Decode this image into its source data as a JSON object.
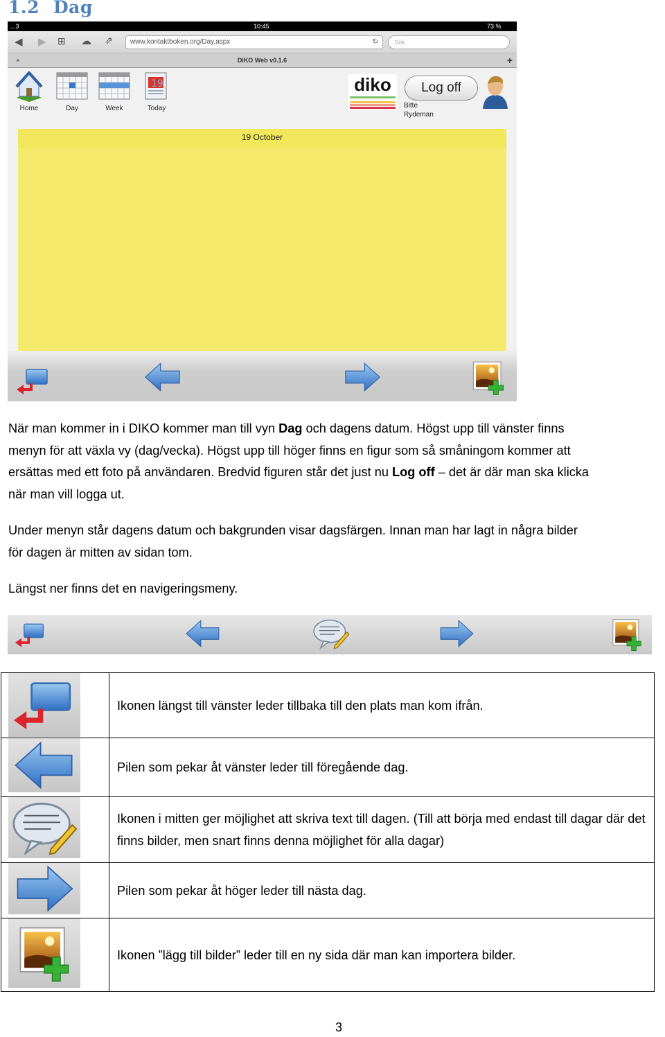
{
  "heading": {
    "number": "1.2",
    "title": "Dag"
  },
  "screenshot": {
    "status": {
      "carrier": "...3",
      "time": "10:45",
      "battery": "73 %"
    },
    "browser": {
      "url": "www.kontaktboken.org/Day.aspx",
      "search_placeholder": "Sök",
      "tab_title": "DIKO Web v0.1.6",
      "close": "×",
      "new_tab": "+"
    },
    "menu": [
      {
        "label": "Home",
        "icon": "house-icon"
      },
      {
        "label": "Day",
        "icon": "day-calendar-icon"
      },
      {
        "label": "Week",
        "icon": "week-calendar-icon"
      },
      {
        "label": "Today",
        "icon": "today-calendar-icon"
      }
    ],
    "logo": "diko",
    "logoff_label": "Log off",
    "user_first": "Bitte",
    "user_last": "Rydeman",
    "date": "19 October",
    "day_color": "#f4e96a"
  },
  "paragraphs": [
    [
      "När man kommer in i DIKO kommer man till vyn ",
      "Dag",
      " och dagens datum. Högst upp till vänster finns"
    ],
    "menyn för att växla vy (dag/vecka). Högst upp till höger finns en figur som så småningom kommer att",
    [
      "ersättas med ett foto på användaren. Bredvid figuren står det just nu ",
      "Log off",
      " – det är där man ska klicka"
    ],
    "när man vill logga ut.",
    "Under menyn står dagens datum och bakgrunden visar dagsfärgen. Innan man har lagt in några bilder",
    "för dagen är mitten av sidan tom.",
    "Längst ner finns det en navigeringsmeny."
  ],
  "icon_table": [
    {
      "icon": "back-return-icon",
      "text": "Ikonen längst till vänster leder tillbaka till den plats man kom ifrån."
    },
    {
      "icon": "arrow-left-icon",
      "text": "Pilen som pekar åt vänster leder till föregående dag."
    },
    {
      "icon": "speech-bubble-pencil-icon",
      "text": "Ikonen i mitten ger möjlighet att skriva text till dagen. (Till att börja med endast till dagar där det finns bilder, men snart finns denna möjlighet för alla dagar)"
    },
    {
      "icon": "arrow-right-icon",
      "text": "Pilen som pekar åt höger leder till nästa dag."
    },
    {
      "icon": "add-picture-icon",
      "text": "Ikonen ”lägg till bilder” leder till en ny sida där man kan importera bilder."
    }
  ],
  "page_number": "3"
}
